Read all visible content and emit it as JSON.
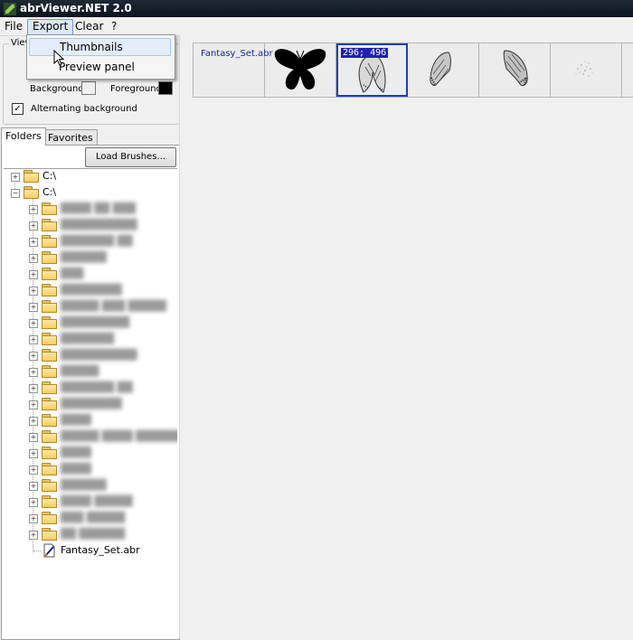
{
  "window": {
    "title": "abrViewer.NET 2.0"
  },
  "menu": {
    "file": "File",
    "export": "Export",
    "clear": "Clear",
    "help": "?"
  },
  "export_menu": {
    "thumbnails": "Thumbnails",
    "preview_panel": "Preview panel"
  },
  "view_group": {
    "legend": "View",
    "background_label": "Background:",
    "foreground_label": "Foreground:",
    "background_color": "#f0f0f0",
    "foreground_color": "#000000",
    "alternating_label": "Alternating background",
    "alternating_checked": true
  },
  "tabs": {
    "folders": "Folders",
    "favorites": "Favorites",
    "active": "Folders"
  },
  "load_button": "Load Brushes...",
  "tree": {
    "drives": [
      "C:\\",
      "C:\\"
    ],
    "hidden_folder_count": 21,
    "file": "Fantasy_Set.abr"
  },
  "thumbnails": {
    "file_label": "Fantasy_Set.abr",
    "selected_coords": "296; 496",
    "brush_icons": [
      "butterfly-brush-icon",
      "wing-brush-icon",
      "wing-brush-icon",
      "wing-brush-icon",
      "sparkle-brush-icon"
    ]
  },
  "colors": {
    "selection_border": "#1e3eb8",
    "file_label_color": "#1a2aa0"
  }
}
